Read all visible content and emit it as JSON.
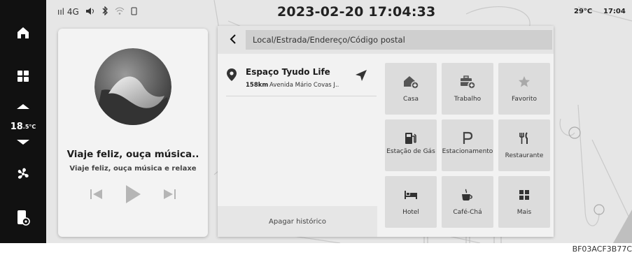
{
  "status_bar": {
    "signal_text": "ııl 4G",
    "datetime": "2023-02-20 17:04:33",
    "temperature": "29°C",
    "time": "17:04"
  },
  "sidebar": {
    "temperature_value": "18",
    "temperature_unit": ".5°C"
  },
  "music": {
    "title": "Viaje feliz, ouça música..",
    "subtitle": "Viaje feliz, ouça música e relaxe"
  },
  "navigation": {
    "search_placeholder": "Local/Estrada/Endereço/Código postal",
    "history": [
      {
        "name": "Espaço Tyudo Life",
        "distance": "158km",
        "address": "Avenida Mário Covas J.."
      }
    ],
    "clear_history_label": "Apagar histórico",
    "shortcuts": [
      {
        "label": "Casa",
        "icon": "home-add-icon"
      },
      {
        "label": "Trabalho",
        "icon": "briefcase-add-icon"
      },
      {
        "label": "Favorito",
        "icon": "star-icon"
      },
      {
        "label": "Estação de Gás",
        "icon": "gas-station-icon"
      },
      {
        "label": "Estacionamento",
        "icon": "parking-icon"
      },
      {
        "label": "Restaurante",
        "icon": "restaurant-icon"
      },
      {
        "label": "Hotel",
        "icon": "hotel-icon"
      },
      {
        "label": "Café-Chá",
        "icon": "coffee-icon"
      },
      {
        "label": "Mais",
        "icon": "more-grid-icon"
      }
    ]
  },
  "image_code": "BF03ACF3B77C"
}
